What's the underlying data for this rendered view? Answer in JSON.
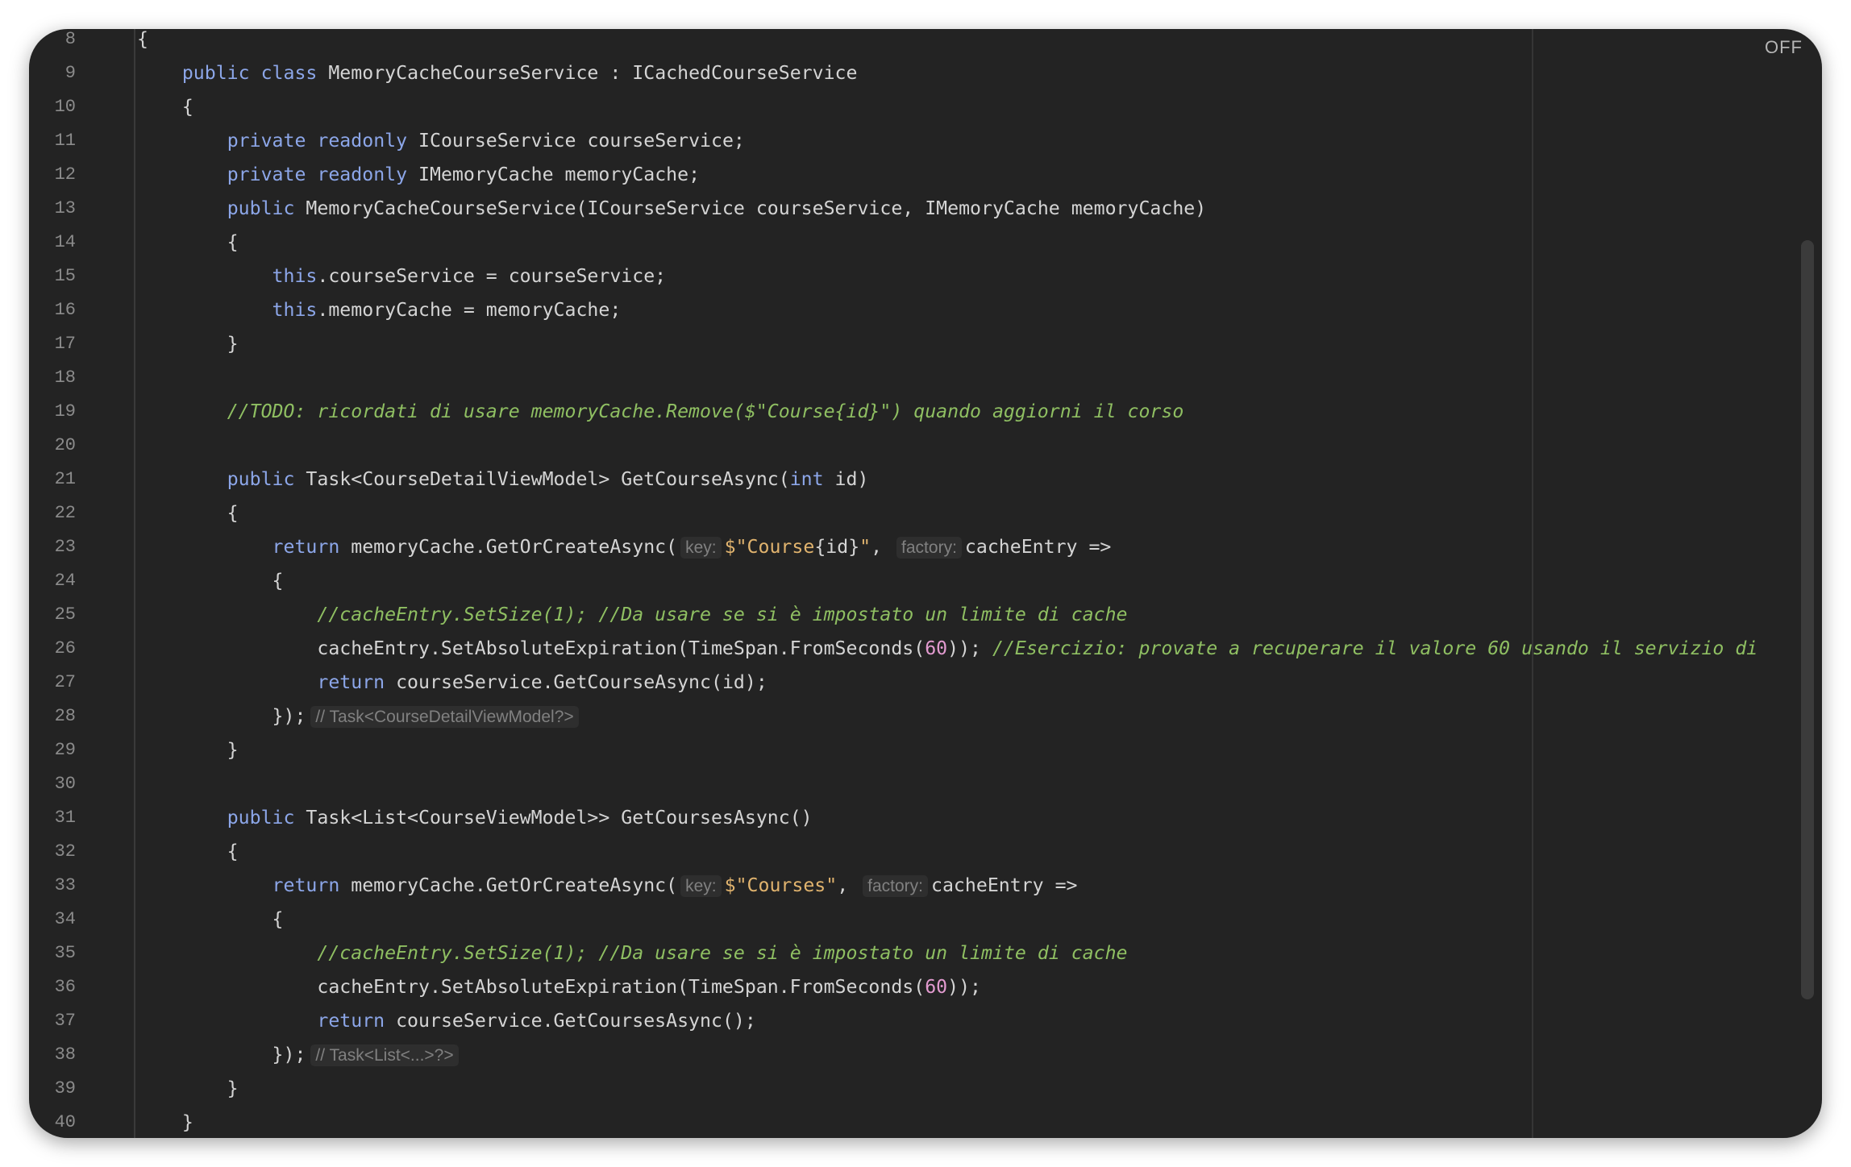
{
  "editor": {
    "inspection_toggle": "OFF",
    "lines": [
      {
        "n": "8",
        "t": [
          {
            "text": "{"
          }
        ]
      },
      {
        "n": "9",
        "t": [
          {
            "text": "    "
          },
          {
            "text": "public",
            "c": "kw"
          },
          {
            "text": " "
          },
          {
            "text": "class",
            "c": "kw"
          },
          {
            "text": " MemoryCacheCourseService : ICachedCourseService"
          }
        ]
      },
      {
        "n": "10",
        "t": [
          {
            "text": "    {"
          }
        ]
      },
      {
        "n": "11",
        "t": [
          {
            "text": "        "
          },
          {
            "text": "private",
            "c": "kw"
          },
          {
            "text": " "
          },
          {
            "text": "readonly",
            "c": "kw"
          },
          {
            "text": " ICourseService courseService;"
          }
        ]
      },
      {
        "n": "12",
        "t": [
          {
            "text": "        "
          },
          {
            "text": "private",
            "c": "kw"
          },
          {
            "text": " "
          },
          {
            "text": "readonly",
            "c": "kw"
          },
          {
            "text": " IMemoryCache memoryCache;"
          }
        ]
      },
      {
        "n": "13",
        "t": [
          {
            "text": "        "
          },
          {
            "text": "public",
            "c": "kw"
          },
          {
            "text": " MemoryCacheCourseService(ICourseService courseService, IMemoryCache memoryCache)"
          }
        ]
      },
      {
        "n": "14",
        "t": [
          {
            "text": "        {"
          }
        ]
      },
      {
        "n": "15",
        "t": [
          {
            "text": "            "
          },
          {
            "text": "this",
            "c": "kw"
          },
          {
            "text": ".courseService = courseService;"
          }
        ]
      },
      {
        "n": "16",
        "t": [
          {
            "text": "            "
          },
          {
            "text": "this",
            "c": "kw"
          },
          {
            "text": ".memoryCache = memoryCache;"
          }
        ]
      },
      {
        "n": "17",
        "t": [
          {
            "text": "        }"
          }
        ]
      },
      {
        "n": "18",
        "t": []
      },
      {
        "n": "19",
        "t": [
          {
            "text": "        "
          },
          {
            "text": "//TODO: ricordati di usare memoryCache.Remove($\"Course{id}\") quando aggiorni il corso",
            "c": "com"
          }
        ]
      },
      {
        "n": "20",
        "t": []
      },
      {
        "n": "21",
        "t": [
          {
            "text": "        "
          },
          {
            "text": "public",
            "c": "kw"
          },
          {
            "text": " Task<CourseDetailViewModel> GetCourseAsync("
          },
          {
            "text": "int",
            "c": "kw"
          },
          {
            "text": " id)"
          }
        ]
      },
      {
        "n": "22",
        "t": [
          {
            "text": "        {"
          }
        ]
      },
      {
        "n": "23",
        "t": [
          {
            "text": "            "
          },
          {
            "text": "return",
            "c": "kw"
          },
          {
            "text": " memoryCache.GetOrCreateAsync("
          },
          {
            "text": "key:",
            "c": "hint"
          },
          {
            "text": "$\"Course",
            "c": "str"
          },
          {
            "text": "{id}"
          },
          {
            "text": "\"",
            "c": "str"
          },
          {
            "text": ", "
          },
          {
            "text": "factory:",
            "c": "hint"
          },
          {
            "text": "cacheEntry =>"
          }
        ]
      },
      {
        "n": "24",
        "t": [
          {
            "text": "            {"
          }
        ]
      },
      {
        "n": "25",
        "t": [
          {
            "text": "                "
          },
          {
            "text": "//cacheEntry.SetSize(1); //Da usare se si è impostato un limite di cache",
            "c": "com"
          }
        ]
      },
      {
        "n": "26",
        "t": [
          {
            "text": "                cacheEntry.SetAbsoluteExpiration(TimeSpan.FromSeconds("
          },
          {
            "text": "60",
            "c": "num"
          },
          {
            "text": ")); "
          },
          {
            "text": "//Esercizio: provate a recuperare il valore 60 usando il servizio di",
            "c": "com"
          }
        ]
      },
      {
        "n": "27",
        "t": [
          {
            "text": "                "
          },
          {
            "text": "return",
            "c": "kw"
          },
          {
            "text": " courseService.GetCourseAsync(id);"
          }
        ]
      },
      {
        "n": "28",
        "t": [
          {
            "text": "            });"
          },
          {
            "text": "// Task<CourseDetailViewModel?>",
            "c": "endhint"
          }
        ]
      },
      {
        "n": "29",
        "t": [
          {
            "text": "        }"
          }
        ]
      },
      {
        "n": "30",
        "t": []
      },
      {
        "n": "31",
        "t": [
          {
            "text": "        "
          },
          {
            "text": "public",
            "c": "kw"
          },
          {
            "text": " Task<List<CourseViewModel>> GetCoursesAsync()"
          }
        ]
      },
      {
        "n": "32",
        "t": [
          {
            "text": "        {"
          }
        ]
      },
      {
        "n": "33",
        "t": [
          {
            "text": "            "
          },
          {
            "text": "return",
            "c": "kw"
          },
          {
            "text": " memoryCache.GetOrCreateAsync("
          },
          {
            "text": "key:",
            "c": "hint"
          },
          {
            "text": "$\"Courses\"",
            "c": "str"
          },
          {
            "text": ", "
          },
          {
            "text": "factory:",
            "c": "hint"
          },
          {
            "text": "cacheEntry =>"
          }
        ]
      },
      {
        "n": "34",
        "t": [
          {
            "text": "            {"
          }
        ]
      },
      {
        "n": "35",
        "t": [
          {
            "text": "                "
          },
          {
            "text": "//cacheEntry.SetSize(1); //Da usare se si è impostato un limite di cache",
            "c": "com"
          }
        ]
      },
      {
        "n": "36",
        "t": [
          {
            "text": "                cacheEntry.SetAbsoluteExpiration(TimeSpan.FromSeconds("
          },
          {
            "text": "60",
            "c": "num"
          },
          {
            "text": "));"
          }
        ]
      },
      {
        "n": "37",
        "t": [
          {
            "text": "                "
          },
          {
            "text": "return",
            "c": "kw"
          },
          {
            "text": " courseService.GetCoursesAsync();"
          }
        ]
      },
      {
        "n": "38",
        "t": [
          {
            "text": "            });"
          },
          {
            "text": "// Task<List<...>?>",
            "c": "endhint"
          }
        ]
      },
      {
        "n": "39",
        "t": [
          {
            "text": "        }"
          }
        ]
      },
      {
        "n": "40",
        "t": [
          {
            "text": "    }"
          }
        ]
      }
    ]
  },
  "colors": {
    "background": "#232323",
    "keyword": "#8ca6e8",
    "string": "#e0b36e",
    "number": "#e39bd0",
    "comment": "#8fbf62",
    "line_number": "#8b8b8b"
  }
}
